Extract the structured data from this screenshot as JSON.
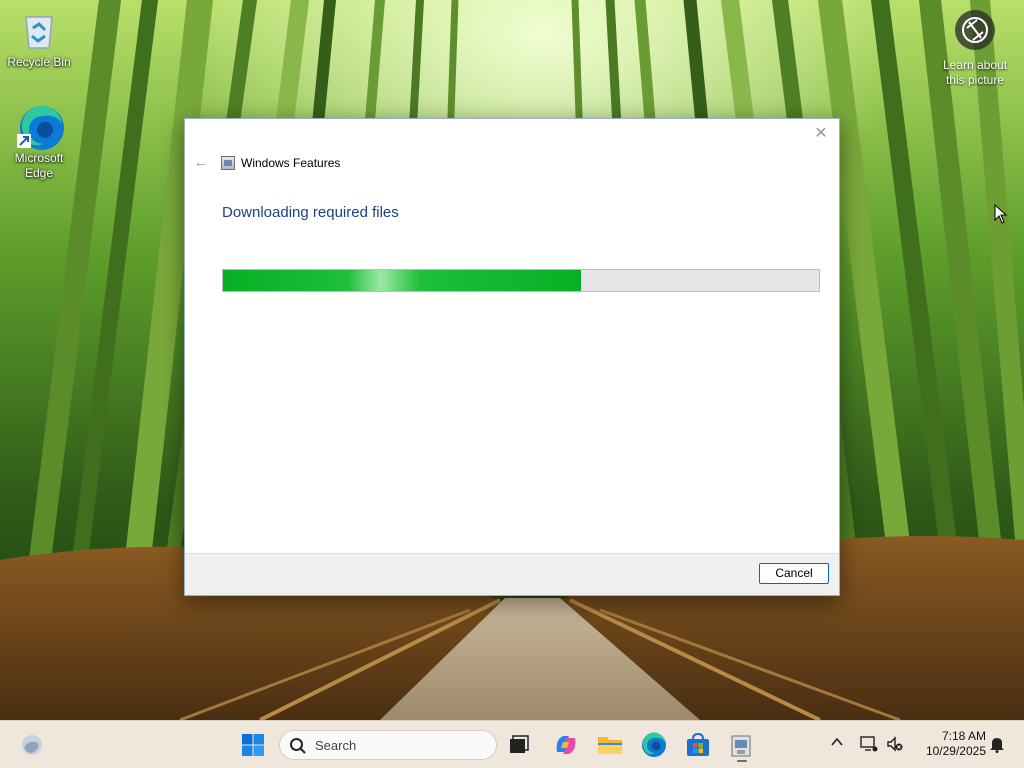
{
  "desktop": {
    "icons": [
      {
        "label": "Recycle Bin"
      },
      {
        "label": "Microsoft Edge"
      }
    ],
    "spotlight": {
      "label_line1": "Learn about",
      "label_line2": "this picture"
    }
  },
  "dialog": {
    "title": "Windows Features",
    "heading": "Downloading required files",
    "progress_fraction": 0.6,
    "progress_color": "#06b025",
    "cancel_label": "Cancel",
    "close_glyph": "✕",
    "back_glyph": "←"
  },
  "taskbar": {
    "search_placeholder": "Search",
    "pinned": [
      "widgets-icon",
      "start-icon",
      "task-view-icon",
      "copilot-icon",
      "file-explorer-icon",
      "edge-icon",
      "store-icon",
      "windows-features-icon"
    ],
    "tray": {
      "overflow_glyph": "^",
      "time": "7:18 AM",
      "date": "10/29/2025"
    }
  }
}
